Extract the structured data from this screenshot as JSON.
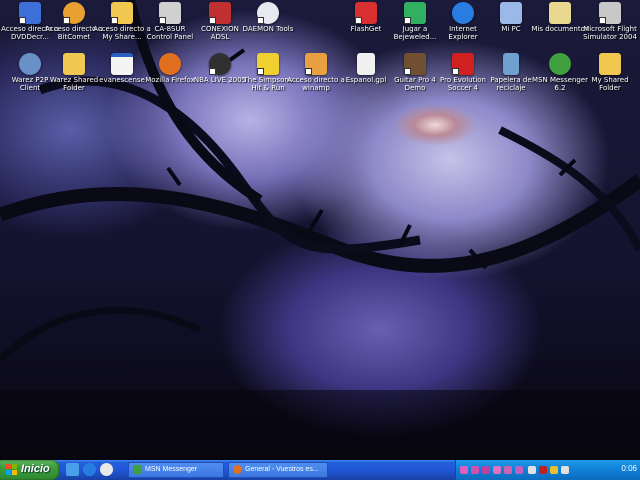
{
  "desktop": {
    "icons": [
      {
        "label": "Acceso directo a DVDDecr...",
        "icon": "dvd-decrypter-icon",
        "color": "#3c6fd8"
      },
      {
        "label": "Acceso directo a BitComet",
        "icon": "bitcomet-icon",
        "color": "#e8a030"
      },
      {
        "label": "Acceso directo a My Share...",
        "icon": "folder-icon",
        "color": "#f0c850"
      },
      {
        "label": "CA-8SUR Control Panel",
        "icon": "control-panel-icon",
        "color": "#d0d0d0"
      },
      {
        "label": "CONEXION ADSL",
        "icon": "network-connection-icon",
        "color": "#c03030"
      },
      {
        "label": "DAEMON Tools",
        "icon": "daemon-tools-icon",
        "color": "#e8e8f0"
      },
      {
        "label": "FlashGet",
        "icon": "flashget-icon",
        "color": "#d83030"
      },
      {
        "label": "Jugar a Bejeweled...",
        "icon": "bejeweled-icon",
        "color": "#30b060"
      },
      {
        "label": "Internet Explorer",
        "icon": "internet-explorer-icon",
        "color": "#2a7de0"
      },
      {
        "label": "Mi PC",
        "icon": "my-computer-icon",
        "color": "#9ab8e8"
      },
      {
        "label": "Mis documentos",
        "icon": "my-documents-icon",
        "color": "#e8d890"
      },
      {
        "label": "Microsoft Flight Simulator 2004",
        "icon": "flight-simulator-icon",
        "color": "#c8c8c8"
      },
      {
        "label": "Warez P2P Client",
        "icon": "warez-p2p-icon",
        "color": "#6a90c8"
      },
      {
        "label": "Warez Shared Folder",
        "icon": "shared-folder-icon",
        "color": "#f0c850"
      },
      {
        "label": "evanescense",
        "icon": "window-icon",
        "color": "#f4f4f4"
      },
      {
        "label": "Mozilla Firefox",
        "icon": "firefox-icon",
        "color": "#e07020"
      },
      {
        "label": "NBA LIVE 2005",
        "icon": "nba-live-icon",
        "color": "#303030"
      },
      {
        "label": "The Simpsons Hit & Run",
        "icon": "simpsons-icon",
        "color": "#f0d030"
      },
      {
        "label": "Acceso directo a winamp",
        "icon": "winamp-icon",
        "color": "#e8a040"
      },
      {
        "label": "Espanol.gpl",
        "icon": "document-icon",
        "color": "#f0f0f0"
      },
      {
        "label": "Guitar Pro 4 Demo",
        "icon": "guitar-pro-icon",
        "color": "#705030"
      },
      {
        "label": "Pro Evolution Soccer 4",
        "icon": "pes4-icon",
        "color": "#d02020"
      },
      {
        "label": "Papelera de reciclaje",
        "icon": "recycle-bin-icon",
        "color": "#70a0d0"
      },
      {
        "label": "MSN Messenger 6.2",
        "icon": "msn-messenger-icon",
        "color": "#40a040"
      },
      {
        "label": "My Shared Folder",
        "icon": "folder-icon",
        "color": "#f0c850"
      }
    ]
  },
  "taskbar": {
    "start_label": "Inicio",
    "quick_launch": [
      {
        "icon": "show-desktop-icon",
        "color": "#4aa0e8"
      },
      {
        "icon": "internet-explorer-icon",
        "color": "#2a7de0"
      },
      {
        "icon": "windows-media-player-icon",
        "color": "#e8e8e8"
      }
    ],
    "tasks": [
      {
        "label": "MSN Messenger",
        "icon": "msn-messenger-icon",
        "color": "#40a040"
      },
      {
        "label": "General - Vuestros es...",
        "icon": "firefox-icon",
        "color": "#e07020"
      }
    ],
    "tray_icons": [
      {
        "icon": "tray-msn-icon",
        "color": "#e060c0"
      },
      {
        "icon": "tray-media-icon",
        "color": "#d050b0"
      },
      {
        "icon": "tray-daemon-icon",
        "color": "#c040a0"
      },
      {
        "icon": "tray-bitcomet-icon",
        "color": "#e070c0"
      },
      {
        "icon": "tray-flashget-icon",
        "color": "#d060b0"
      },
      {
        "icon": "tray-network-icon",
        "color": "#c060c0"
      },
      {
        "icon": "tray-volume-icon",
        "color": "#e0e0e0"
      },
      {
        "icon": "tray-antivirus-icon",
        "color": "#c02020"
      },
      {
        "icon": "tray-security-icon",
        "color": "#e8c030"
      },
      {
        "icon": "tray-update-icon",
        "color": "#e0e0e0"
      }
    ],
    "clock": "0:06"
  }
}
